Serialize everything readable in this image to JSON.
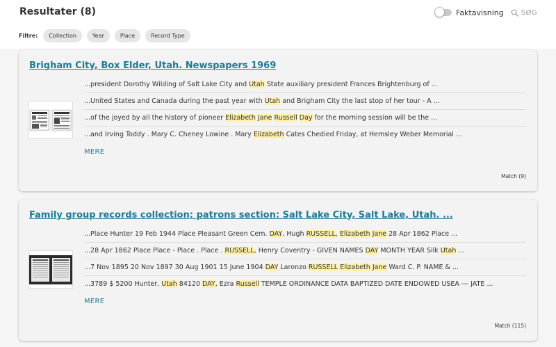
{
  "header": {
    "title": "Resultater (8)",
    "fact_toggle_label": "Faktavisning",
    "search_label": "SØG"
  },
  "filters": {
    "label": "Filtre:",
    "chips": [
      "Collection",
      "Year",
      "Place",
      "Record Type"
    ]
  },
  "results": [
    {
      "title": "Brigham City, Box Elder, Utah. Newspapers 1969",
      "snippets": [
        [
          {
            "t": "...president Dorothy Wilding of Salt Lake City and "
          },
          {
            "t": "Utah",
            "h": true
          },
          {
            "t": " State auxiliary president Frances Brightenburg of ..."
          }
        ],
        [
          {
            "t": "...United States and Canada during the past year with "
          },
          {
            "t": "Utah",
            "h": true
          },
          {
            "t": " and Brigham City the last stop of her tour - A ..."
          }
        ],
        [
          {
            "t": "...of the joyed by all the history of pioneer "
          },
          {
            "t": "Elizabeth",
            "h": true
          },
          {
            "t": " "
          },
          {
            "t": "Jane",
            "h": true
          },
          {
            "t": " "
          },
          {
            "t": "Russell",
            "h": true
          },
          {
            "t": " "
          },
          {
            "t": "Day",
            "h": true
          },
          {
            "t": " for the morning session will be the ..."
          }
        ],
        [
          {
            "t": "...and Irving Toddy . Mary C. Cheney Lowine . Mary "
          },
          {
            "t": "Elizabeth",
            "h": true
          },
          {
            "t": " Cates Chedied Friday, at Hemsley Weber Memorial ..."
          }
        ]
      ],
      "more_label": "MERE",
      "match_label": "Match (9)"
    },
    {
      "title": "Family group records collection; patrons section: Salt Lake City, Salt Lake, Utah. ...",
      "snippets": [
        [
          {
            "t": "...Place Hunter 19 Feb 1944 Place Pleasant Green Cem. "
          },
          {
            "t": "DAY",
            "h": true
          },
          {
            "t": ", Hugh "
          },
          {
            "t": "RUSSELL",
            "h": true
          },
          {
            "t": ", "
          },
          {
            "t": "Elizabeth",
            "h": true
          },
          {
            "t": " "
          },
          {
            "t": "Jane",
            "h": true
          },
          {
            "t": " 28 Apr 1862 Place ..."
          }
        ],
        [
          {
            "t": "...28 Apr 1862 Place Place - Place . Place . "
          },
          {
            "t": "RUSSELL",
            "h": true
          },
          {
            "t": ", Henry Coventry - GIVEN NAMES "
          },
          {
            "t": "DAY",
            "h": true
          },
          {
            "t": " MONTH YEAR Silk "
          },
          {
            "t": "Utah",
            "h": true
          },
          {
            "t": " ..."
          }
        ],
        [
          {
            "t": "...7 Nov 1895 20 Nov 1897 30 Aug 1901 15 June 1904 "
          },
          {
            "t": "DAY",
            "h": true
          },
          {
            "t": " Laronzo "
          },
          {
            "t": "RUSSELL",
            "h": true
          },
          {
            "t": " "
          },
          {
            "t": "Elizabeth",
            "h": true
          },
          {
            "t": " "
          },
          {
            "t": "Jane",
            "h": true
          },
          {
            "t": " Ward C. P. NAME & ..."
          }
        ],
        [
          {
            "t": "...3789 $ 5200 Hunter, "
          },
          {
            "t": "Utah",
            "h": true
          },
          {
            "t": " 84120 "
          },
          {
            "t": "DAY",
            "h": true
          },
          {
            "t": ", Ezra "
          },
          {
            "t": "Russell",
            "h": true
          },
          {
            "t": " TEMPLE ORDINANCE DATA BAPTIZED DATE ENDOWED USEA --- JATE ..."
          }
        ]
      ],
      "more_label": "MERE",
      "match_label": "Match (115)"
    }
  ]
}
